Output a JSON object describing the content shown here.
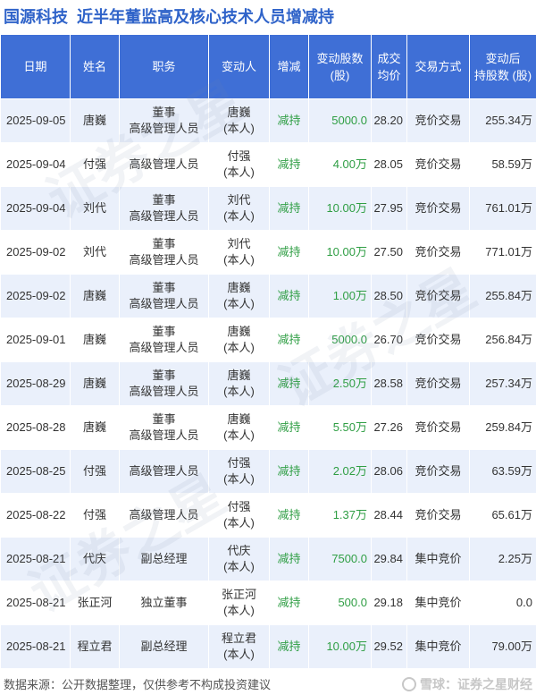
{
  "header": {
    "company": "国源科技",
    "title": "近半年董监高及核心技术人员增减持"
  },
  "columns": [
    {
      "l1": "日期",
      "l2": ""
    },
    {
      "l1": "姓名",
      "l2": ""
    },
    {
      "l1": "职务",
      "l2": ""
    },
    {
      "l1": "变动人",
      "l2": ""
    },
    {
      "l1": "增减",
      "l2": ""
    },
    {
      "l1": "变动股数",
      "l2": "(股)"
    },
    {
      "l1": "成交",
      "l2": "均价"
    },
    {
      "l1": "交易方式",
      "l2": ""
    },
    {
      "l1": "变动后",
      "l2": "持股数 (股)"
    }
  ],
  "rows": [
    {
      "date": "2025-09-05",
      "name": "唐巍",
      "role1": "董事",
      "role2": "高级管理人员",
      "changer1": "唐巍",
      "changer2": "(本人)",
      "dir": "减持",
      "shares": "5000.0",
      "price": "28.20",
      "method": "竞价交易",
      "after": "255.34万"
    },
    {
      "date": "2025-09-04",
      "name": "付强",
      "role1": "高级管理人员",
      "role2": "",
      "changer1": "付强",
      "changer2": "(本人)",
      "dir": "减持",
      "shares": "4.00万",
      "price": "28.05",
      "method": "竞价交易",
      "after": "58.59万"
    },
    {
      "date": "2025-09-04",
      "name": "刘代",
      "role1": "董事",
      "role2": "高级管理人员",
      "changer1": "刘代",
      "changer2": "(本人)",
      "dir": "减持",
      "shares": "10.00万",
      "price": "27.95",
      "method": "竞价交易",
      "after": "761.01万"
    },
    {
      "date": "2025-09-02",
      "name": "刘代",
      "role1": "董事",
      "role2": "高级管理人员",
      "changer1": "刘代",
      "changer2": "(本人)",
      "dir": "减持",
      "shares": "10.00万",
      "price": "27.50",
      "method": "竞价交易",
      "after": "771.01万"
    },
    {
      "date": "2025-09-02",
      "name": "唐巍",
      "role1": "董事",
      "role2": "高级管理人员",
      "changer1": "唐巍",
      "changer2": "(本人)",
      "dir": "减持",
      "shares": "1.00万",
      "price": "28.50",
      "method": "竞价交易",
      "after": "255.84万"
    },
    {
      "date": "2025-09-01",
      "name": "唐巍",
      "role1": "董事",
      "role2": "高级管理人员",
      "changer1": "唐巍",
      "changer2": "(本人)",
      "dir": "减持",
      "shares": "5000.0",
      "price": "26.70",
      "method": "竞价交易",
      "after": "256.84万"
    },
    {
      "date": "2025-08-29",
      "name": "唐巍",
      "role1": "董事",
      "role2": "高级管理人员",
      "changer1": "唐巍",
      "changer2": "(本人)",
      "dir": "减持",
      "shares": "2.50万",
      "price": "28.58",
      "method": "竞价交易",
      "after": "257.34万"
    },
    {
      "date": "2025-08-28",
      "name": "唐巍",
      "role1": "董事",
      "role2": "高级管理人员",
      "changer1": "唐巍",
      "changer2": "(本人)",
      "dir": "减持",
      "shares": "5.50万",
      "price": "27.26",
      "method": "竞价交易",
      "after": "259.84万"
    },
    {
      "date": "2025-08-25",
      "name": "付强",
      "role1": "高级管理人员",
      "role2": "",
      "changer1": "付强",
      "changer2": "(本人)",
      "dir": "减持",
      "shares": "2.02万",
      "price": "28.06",
      "method": "竞价交易",
      "after": "63.59万"
    },
    {
      "date": "2025-08-22",
      "name": "付强",
      "role1": "高级管理人员",
      "role2": "",
      "changer1": "付强",
      "changer2": "(本人)",
      "dir": "减持",
      "shares": "1.37万",
      "price": "28.44",
      "method": "竞价交易",
      "after": "65.61万"
    },
    {
      "date": "2025-08-21",
      "name": "代庆",
      "role1": "副总经理",
      "role2": "",
      "changer1": "代庆",
      "changer2": "(本人)",
      "dir": "减持",
      "shares": "7500.0",
      "price": "29.84",
      "method": "集中竞价",
      "after": "2.25万"
    },
    {
      "date": "2025-08-21",
      "name": "张正河",
      "role1": "独立董事",
      "role2": "",
      "changer1": "张正河",
      "changer2": "(本人)",
      "dir": "减持",
      "shares": "500.0",
      "price": "29.18",
      "method": "集中竞价",
      "after": "0.0"
    },
    {
      "date": "2025-08-21",
      "name": "程立君",
      "role1": "副总经理",
      "role2": "",
      "changer1": "程立君",
      "changer2": "(本人)",
      "dir": "减持",
      "shares": "10.00万",
      "price": "29.52",
      "method": "集中竞价",
      "after": "79.00万"
    }
  ],
  "footer": {
    "source": "数据来源：公开数据整理，仅供参考不构成投资建议",
    "brand": "雪球：证券之星财经"
  },
  "watermark": [
    "证券之星",
    "证券之星",
    "证券之星"
  ],
  "colors": {
    "header_bg": "#3f6fd6",
    "title": "#2f63c9",
    "decrease": "#2f9e44",
    "row_alt": "#eaf0fb"
  }
}
